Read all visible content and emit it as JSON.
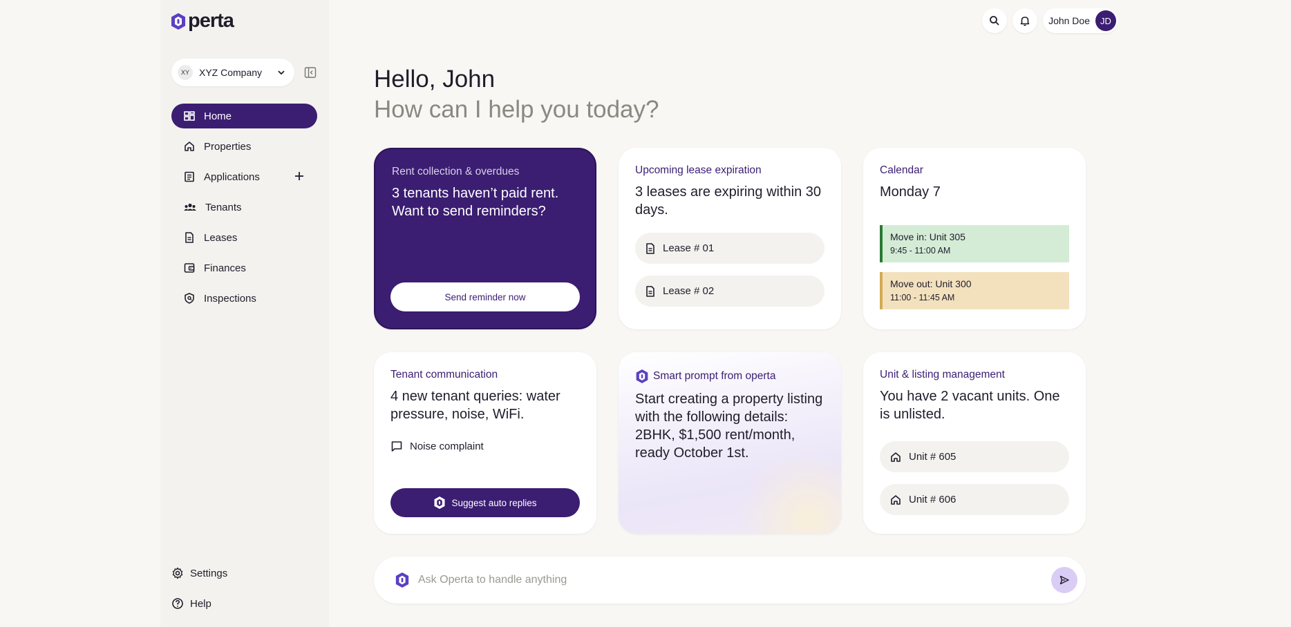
{
  "app": {
    "logo_text": "perta"
  },
  "sidebar": {
    "company": {
      "initials": "XY",
      "name": "XYZ Company"
    },
    "items": [
      {
        "label": "Home",
        "icon": "dashboard-icon"
      },
      {
        "label": "Properties",
        "icon": "home-icon"
      },
      {
        "label": "Applications",
        "icon": "document-list-icon"
      },
      {
        "label": "Tenants",
        "icon": "users-icon"
      },
      {
        "label": "Leases",
        "icon": "file-icon"
      },
      {
        "label": "Finances",
        "icon": "wallet-icon"
      },
      {
        "label": "Inspections",
        "icon": "shield-icon"
      }
    ],
    "bottom": [
      {
        "label": "Settings",
        "icon": "gear-icon"
      },
      {
        "label": "Help",
        "icon": "help-icon"
      }
    ]
  },
  "header": {
    "user_name": "John Doe",
    "user_initials": "JD"
  },
  "greeting": {
    "hello": "Hello, John",
    "subtitle": "How can I help you today?"
  },
  "cards": {
    "rent": {
      "label": "Rent collection & overdues",
      "title": "3 tenants haven’t paid rent. Want to send reminders?",
      "button": "Send reminder now"
    },
    "lease": {
      "label": "Upcoming lease expiration",
      "title": "3 leases are expiring within 30 days.",
      "items": [
        "Lease # 01",
        "Lease # 02"
      ]
    },
    "calendar": {
      "label": "Calendar",
      "title": "Monday 7",
      "events": [
        {
          "title": "Move in: Unit 305",
          "time": "9:45 - 11:00 AM",
          "color": "#d4ecd6"
        },
        {
          "title": "Move out: Unit 300",
          "time": "11:00 - 11:45 AM",
          "color": "#f3e1bd"
        }
      ]
    },
    "tenant_comm": {
      "label": "Tenant communication",
      "title": "4 new tenant queries: water pressure, noise, WiFi.",
      "item": "Noise complaint",
      "button": "Suggest auto replies"
    },
    "smart": {
      "label": "Smart prompt from operta",
      "title": "Start creating a property listing with the following details: 2BHK, $1,500 rent/month, ready October 1st."
    },
    "units": {
      "label": "Unit & listing management",
      "title": "You have 2 vacant units. One is unlisted.",
      "items": [
        "Unit # 605",
        "Unit # 606"
      ]
    }
  },
  "ask": {
    "placeholder": "Ask Operta to handle anything"
  },
  "colors": {
    "brand": "#3b1d72",
    "background": "#f8f7f4",
    "accent_light": "#d9cdf5"
  }
}
